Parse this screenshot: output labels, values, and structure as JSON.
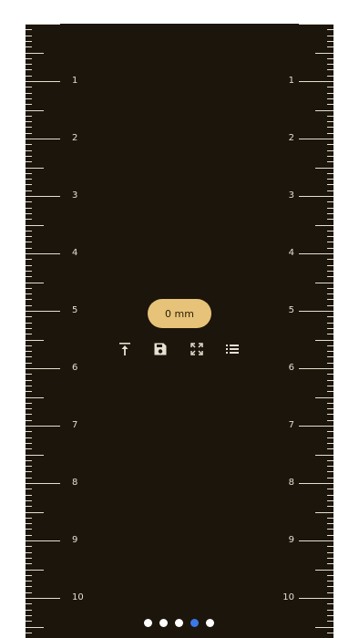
{
  "ruler": {
    "left_labels": [
      "1",
      "2",
      "3",
      "4",
      "5",
      "6",
      "7",
      "8",
      "9",
      "10"
    ],
    "right_labels": [
      "1",
      "2",
      "3",
      "4",
      "5",
      "6",
      "7",
      "8",
      "9",
      "10"
    ]
  },
  "measurement": {
    "value_label": "0 mm"
  },
  "toolbar": {
    "items": [
      {
        "icon": "align-top-icon"
      },
      {
        "icon": "save-icon"
      },
      {
        "icon": "fullscreen-icon"
      },
      {
        "icon": "list-icon"
      }
    ]
  },
  "pager": {
    "count": 5,
    "active_index": 3,
    "active_color": "#3b78e7",
    "inactive_color": "#ffffff"
  },
  "colors": {
    "background": "#1b150b",
    "ticks": "#e6e0d2",
    "pill": "#e6c378"
  }
}
